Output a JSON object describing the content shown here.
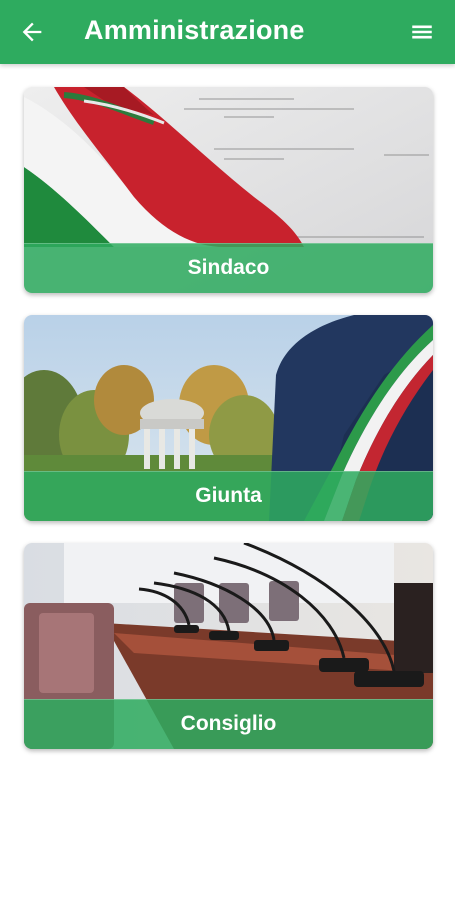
{
  "header": {
    "title": "Amministrazione",
    "back_icon": "arrow-left-icon",
    "menu_icon": "hamburger-menu-icon",
    "color": "#2eab5f"
  },
  "cards": [
    {
      "label": "Sindaco",
      "image": "italian-flag-document-image"
    },
    {
      "label": "Giunta",
      "image": "mayor-sash-park-image"
    },
    {
      "label": "Consiglio",
      "image": "council-chamber-microphones-image"
    }
  ]
}
